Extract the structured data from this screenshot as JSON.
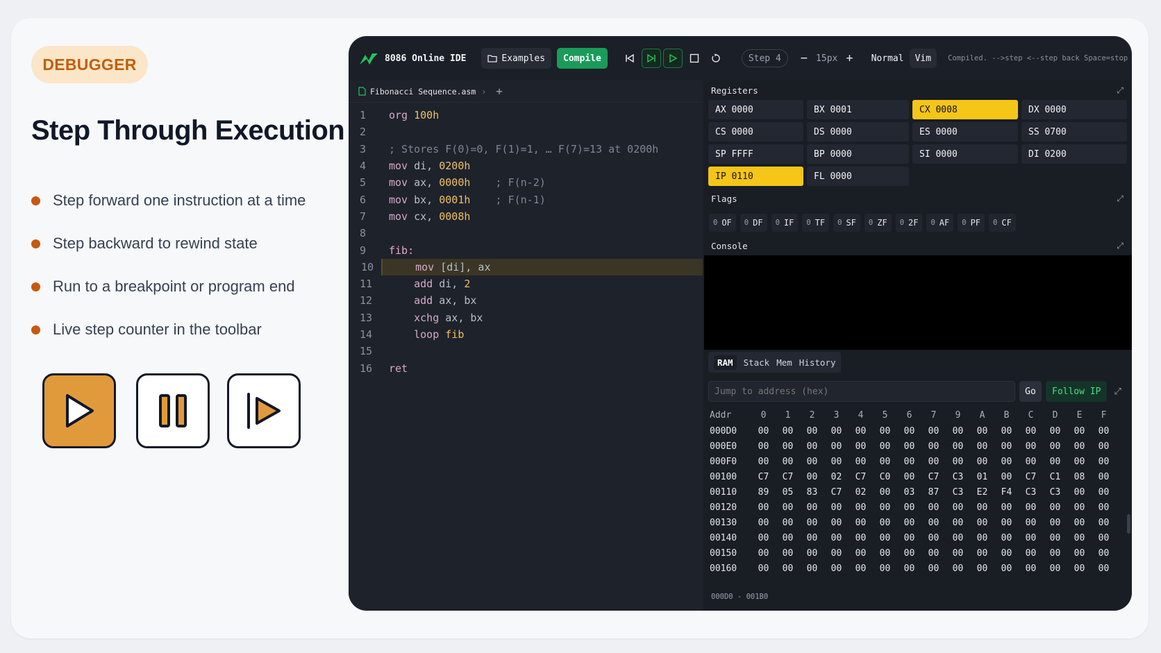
{
  "slide": {
    "badge": "DEBUGGER",
    "title": "Step Through Execution",
    "bullets": [
      "Step forward one instruction at a time",
      "Step backward to rewind state",
      "Run to a breakpoint or program end",
      "Live step counter in the toolbar"
    ],
    "controls": [
      "play-icon",
      "pause-icon",
      "step-forward-icon"
    ],
    "accent_color": "#c8580f"
  },
  "ide": {
    "title": "8086 Online IDE",
    "examples_label": "Examples",
    "compile_label": "Compile",
    "step_label": "Step 4",
    "zoom_minus": "−",
    "zoom_value": "15px",
    "zoom_plus": "+",
    "mode_label": "Normal",
    "vim_label": "Vim",
    "status_text": "Compiled. -->step <--step back Space=stop",
    "file_tab": "Fibonacci Sequence.asm",
    "add_tab": "+",
    "current_line": 10,
    "code": [
      {
        "n": "1",
        "t": "org 100h"
      },
      {
        "n": "2",
        "t": ""
      },
      {
        "n": "3",
        "t": "; Stores F(0)=0, F(1)=1, … F(7)=13 at 0200h"
      },
      {
        "n": "4",
        "t": "mov di, 0200h"
      },
      {
        "n": "5",
        "t": "mov ax, 0000h    ; F(n-2)"
      },
      {
        "n": "6",
        "t": "mov bx, 0001h    ; F(n-1)"
      },
      {
        "n": "7",
        "t": "mov cx, 0008h"
      },
      {
        "n": "8",
        "t": ""
      },
      {
        "n": "9",
        "t": "fib:"
      },
      {
        "n": "10",
        "t": "    mov [di], ax"
      },
      {
        "n": "11",
        "t": "    add di, 2"
      },
      {
        "n": "12",
        "t": "    add ax, bx"
      },
      {
        "n": "13",
        "t": "    xchg ax, bx"
      },
      {
        "n": "14",
        "t": "    loop fib"
      },
      {
        "n": "15",
        "t": ""
      },
      {
        "n": "16",
        "t": "ret"
      }
    ],
    "registers_title": "Registers",
    "registers": [
      {
        "name": "AX",
        "value": "0000",
        "hl": false
      },
      {
        "name": "BX",
        "value": "0001",
        "hl": false
      },
      {
        "name": "CX",
        "value": "0008",
        "hl": true
      },
      {
        "name": "DX",
        "value": "0000",
        "hl": false
      },
      {
        "name": "CS",
        "value": "0000",
        "hl": false
      },
      {
        "name": "DS",
        "value": "0000",
        "hl": false
      },
      {
        "name": "ES",
        "value": "0000",
        "hl": false
      },
      {
        "name": "SS",
        "value": "0700",
        "hl": false
      },
      {
        "name": "SP",
        "value": "FFFF",
        "hl": false
      },
      {
        "name": "BP",
        "value": "0000",
        "hl": false
      },
      {
        "name": "SI",
        "value": "0000",
        "hl": false
      },
      {
        "name": "DI",
        "value": "0200",
        "hl": false
      },
      {
        "name": "IP",
        "value": "0110",
        "hl": true
      },
      {
        "name": "FL",
        "value": "0000",
        "hl": false
      }
    ],
    "flags_title": "Flags",
    "flags": [
      {
        "v": "0",
        "n": "OF"
      },
      {
        "v": "0",
        "n": "DF"
      },
      {
        "v": "0",
        "n": "IF"
      },
      {
        "v": "0",
        "n": "TF"
      },
      {
        "v": "0",
        "n": "SF"
      },
      {
        "v": "0",
        "n": "ZF"
      },
      {
        "v": "0",
        "n": "2F"
      },
      {
        "v": "0",
        "n": "AF"
      },
      {
        "v": "0",
        "n": "PF"
      },
      {
        "v": "0",
        "n": "CF"
      }
    ],
    "console_title": "Console",
    "mem_tabs": [
      "RAM",
      "Stack",
      "Mem",
      "History"
    ],
    "address_placeholder": "Jump to address (hex)",
    "go_label": "Go",
    "follow_label": "Follow IP",
    "mem_header": [
      "Addr",
      "0",
      "1",
      "2",
      "3",
      "4",
      "5",
      "6",
      "7",
      "9",
      "A",
      "B",
      "C",
      "D",
      "E",
      "F"
    ],
    "mem_rows": [
      [
        "000D0",
        "00",
        "00",
        "00",
        "00",
        "00",
        "00",
        "00",
        "00",
        "00",
        "00",
        "00",
        "00",
        "00",
        "00",
        "00"
      ],
      [
        "000E0",
        "00",
        "00",
        "00",
        "00",
        "00",
        "00",
        "00",
        "00",
        "00",
        "00",
        "00",
        "00",
        "00",
        "00",
        "00"
      ],
      [
        "000F0",
        "00",
        "00",
        "00",
        "00",
        "00",
        "00",
        "00",
        "00",
        "00",
        "00",
        "00",
        "00",
        "00",
        "00",
        "00"
      ],
      [
        "00100",
        "C7",
        "C7",
        "00",
        "02",
        "C7",
        "C0",
        "00",
        "C7",
        "C3",
        "01",
        "00",
        "C7",
        "C1",
        "08",
        "00"
      ],
      [
        "00110",
        "89",
        "05",
        "83",
        "C7",
        "02",
        "00",
        "03",
        "87",
        "C3",
        "E2",
        "F4",
        "C3",
        "C3",
        "00",
        "00"
      ],
      [
        "00120",
        "00",
        "00",
        "00",
        "00",
        "00",
        "00",
        "00",
        "00",
        "00",
        "00",
        "00",
        "00",
        "00",
        "00",
        "00"
      ],
      [
        "00130",
        "00",
        "00",
        "00",
        "00",
        "00",
        "00",
        "00",
        "00",
        "00",
        "00",
        "00",
        "00",
        "00",
        "00",
        "00"
      ],
      [
        "00140",
        "00",
        "00",
        "00",
        "00",
        "00",
        "00",
        "00",
        "00",
        "00",
        "00",
        "00",
        "00",
        "00",
        "00",
        "00"
      ],
      [
        "00150",
        "00",
        "00",
        "00",
        "00",
        "00",
        "00",
        "00",
        "00",
        "00",
        "00",
        "00",
        "00",
        "00",
        "00",
        "00"
      ],
      [
        "00160",
        "00",
        "00",
        "00",
        "00",
        "00",
        "00",
        "00",
        "00",
        "00",
        "00",
        "00",
        "00",
        "00",
        "00",
        "00"
      ]
    ],
    "mem_range": "000D0 - 001B0",
    "highlight_color": "#f5c518",
    "compile_color": "#1a9b5a"
  }
}
